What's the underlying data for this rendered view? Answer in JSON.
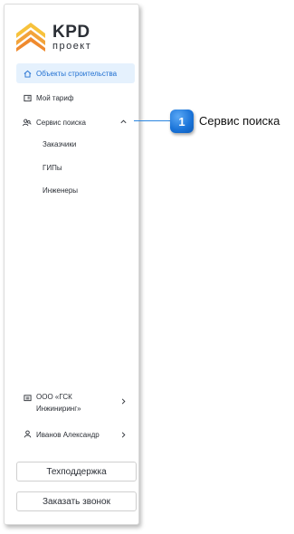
{
  "logo": {
    "brand": "KPD",
    "subtitle": "проект",
    "colors": [
      "#f7c23c",
      "#f2a33a",
      "#ef8a2e"
    ]
  },
  "nav": {
    "items": [
      {
        "label": "Объекты строительства",
        "icon": "home-icon",
        "active": true
      },
      {
        "label": "Мой тариф",
        "icon": "tariff-icon",
        "active": false
      },
      {
        "label": "Сервис поиска",
        "icon": "search-people-icon",
        "active": false,
        "expanded": true
      }
    ],
    "subitems": [
      "Заказчики",
      "ГИПы",
      "Инженеры"
    ]
  },
  "footer": {
    "company": "ООО «ГСК Инжиниринг»",
    "user": "Иванов Александр"
  },
  "buttons": {
    "support": "Техподдержка",
    "callback": "Заказать звонок"
  },
  "callout": {
    "number": "1",
    "label": "Сервис поиска",
    "color": "#1a73d8"
  },
  "colors": {
    "accent": "#1f6fd1",
    "active_bg": "#e5f1fd"
  }
}
